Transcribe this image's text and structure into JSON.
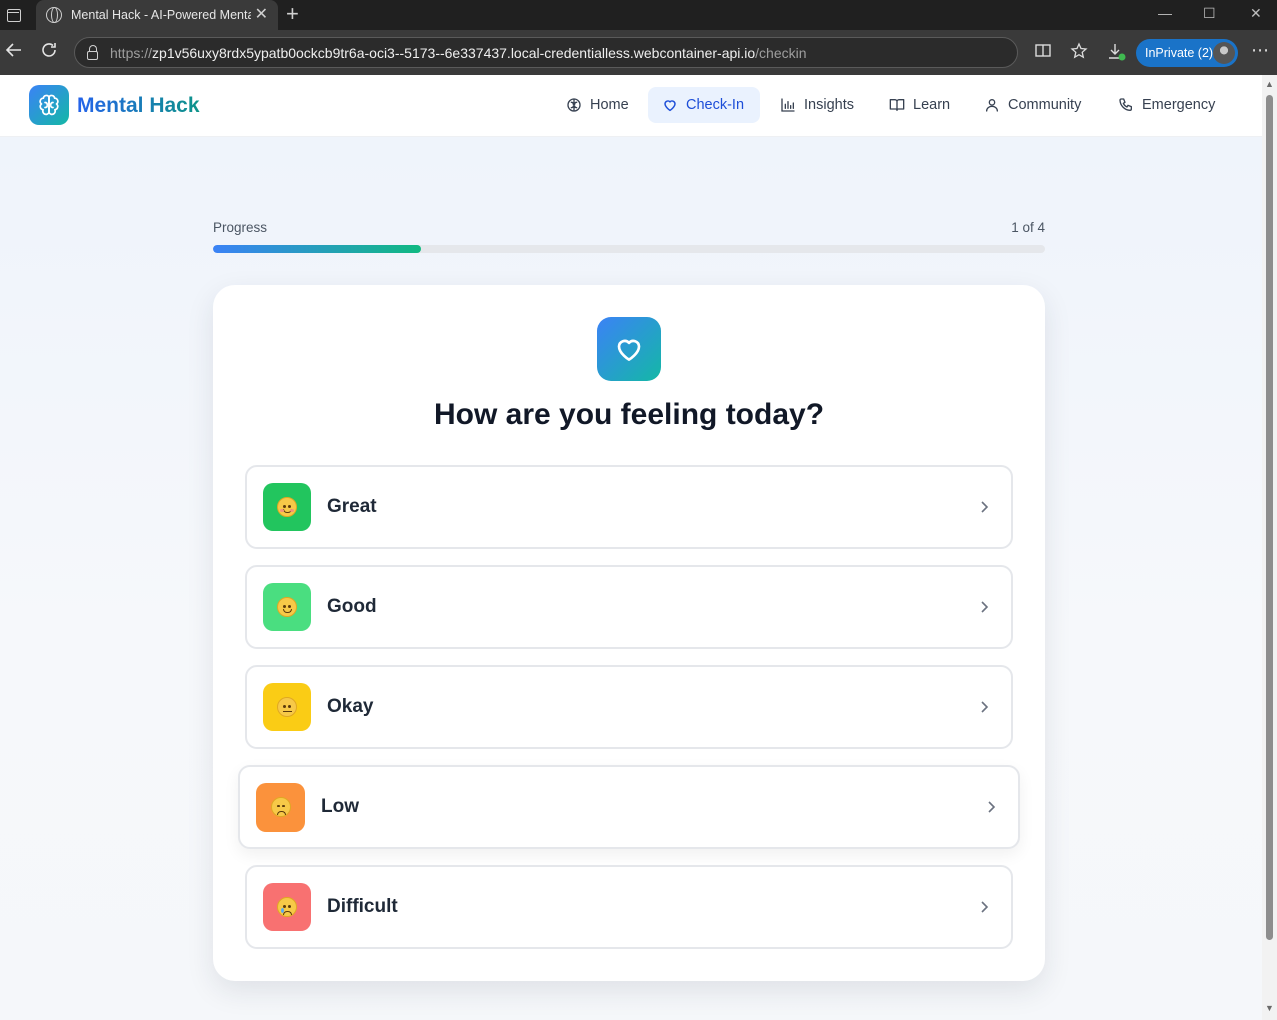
{
  "browser": {
    "tab_title": "Mental Hack - AI-Powered Mental",
    "url_prefix": "https://",
    "url_host": "zp1v56uxy8rdx5ypatb0ockcb9tr6a-oci3--5173--6e337437.local-credentialless.webcontainer-api.io",
    "url_path": "/checkin",
    "inprivate_label": "InPrivate (2)"
  },
  "header": {
    "brand": "Mental Hack",
    "nav": [
      {
        "label": "Home",
        "icon": "brain-icon",
        "active": false
      },
      {
        "label": "Check-In",
        "icon": "heart-icon",
        "active": true
      },
      {
        "label": "Insights",
        "icon": "bar-chart-icon",
        "active": false
      },
      {
        "label": "Learn",
        "icon": "book-icon",
        "active": false
      },
      {
        "label": "Community",
        "icon": "user-icon",
        "active": false
      },
      {
        "label": "Emergency",
        "icon": "phone-icon",
        "active": false
      }
    ]
  },
  "progress": {
    "label": "Progress",
    "count": "1 of 4",
    "fraction": 0.25
  },
  "checkin": {
    "question": "How are you feeling today?",
    "options": [
      {
        "label": "Great",
        "color": "#22c55e",
        "face": "smile-blush"
      },
      {
        "label": "Good",
        "color": "#4ade80",
        "face": "smile"
      },
      {
        "label": "Okay",
        "color": "#facc15",
        "face": "neutral"
      },
      {
        "label": "Low",
        "color": "#fb923c",
        "face": "pensive"
      },
      {
        "label": "Difficult",
        "color": "#f87171",
        "face": "crying"
      }
    ]
  },
  "colors": {
    "brand_gradient_start": "#3b82f6",
    "brand_gradient_end": "#14b8a6",
    "active_nav_bg": "#eaf2fe",
    "active_nav_text": "#1d4ed8"
  }
}
